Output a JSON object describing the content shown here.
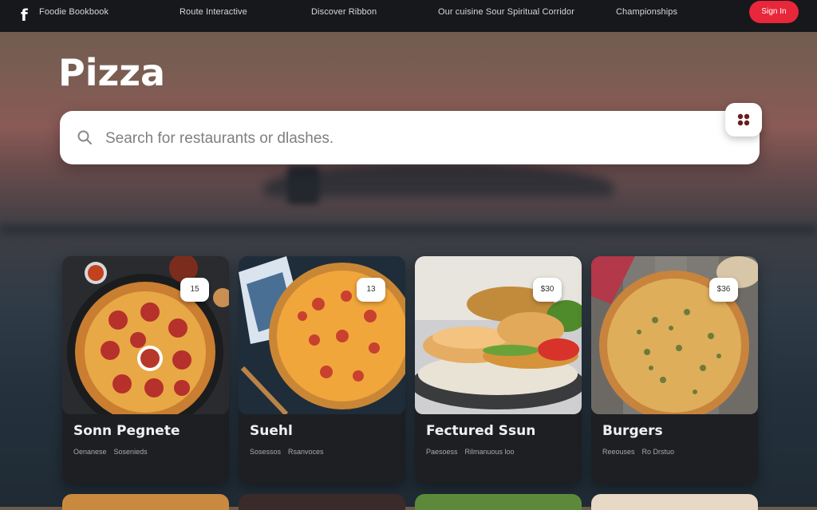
{
  "nav": {
    "logo": "f",
    "links": [
      "Foodie Bookbook",
      "Route Interactive",
      "Discover Ribbon",
      "Our cuisine Sour Spiritual Corridor",
      "Championships"
    ],
    "cta_label": "Sign In"
  },
  "hero": {
    "title": "Pizza"
  },
  "search": {
    "placeholder": "Search for restaurants or dlashes."
  },
  "cards": [
    {
      "title": "Sonn Pegnete",
      "badge": "15",
      "meta": [
        "Oenanese",
        "Sosenieds"
      ]
    },
    {
      "title": "Suehl",
      "badge": "13",
      "meta": [
        "Sosessos",
        "Rsanvoces"
      ]
    },
    {
      "title": "Fectured Ssun",
      "badge": "$30",
      "meta": [
        "Paesoess",
        "Rilmanuous loo"
      ]
    },
    {
      "title": "Burgers",
      "badge": "$36",
      "meta": [
        "Reeouses",
        "Ro Drstuo"
      ]
    }
  ],
  "colors": {
    "nav_bg": "#17181b",
    "cta": "#e8273b",
    "card_bg": "#1e1f23"
  },
  "icons": {
    "logo": "facebook-f-icon",
    "search": "search-icon",
    "filter": "filter-icon"
  }
}
